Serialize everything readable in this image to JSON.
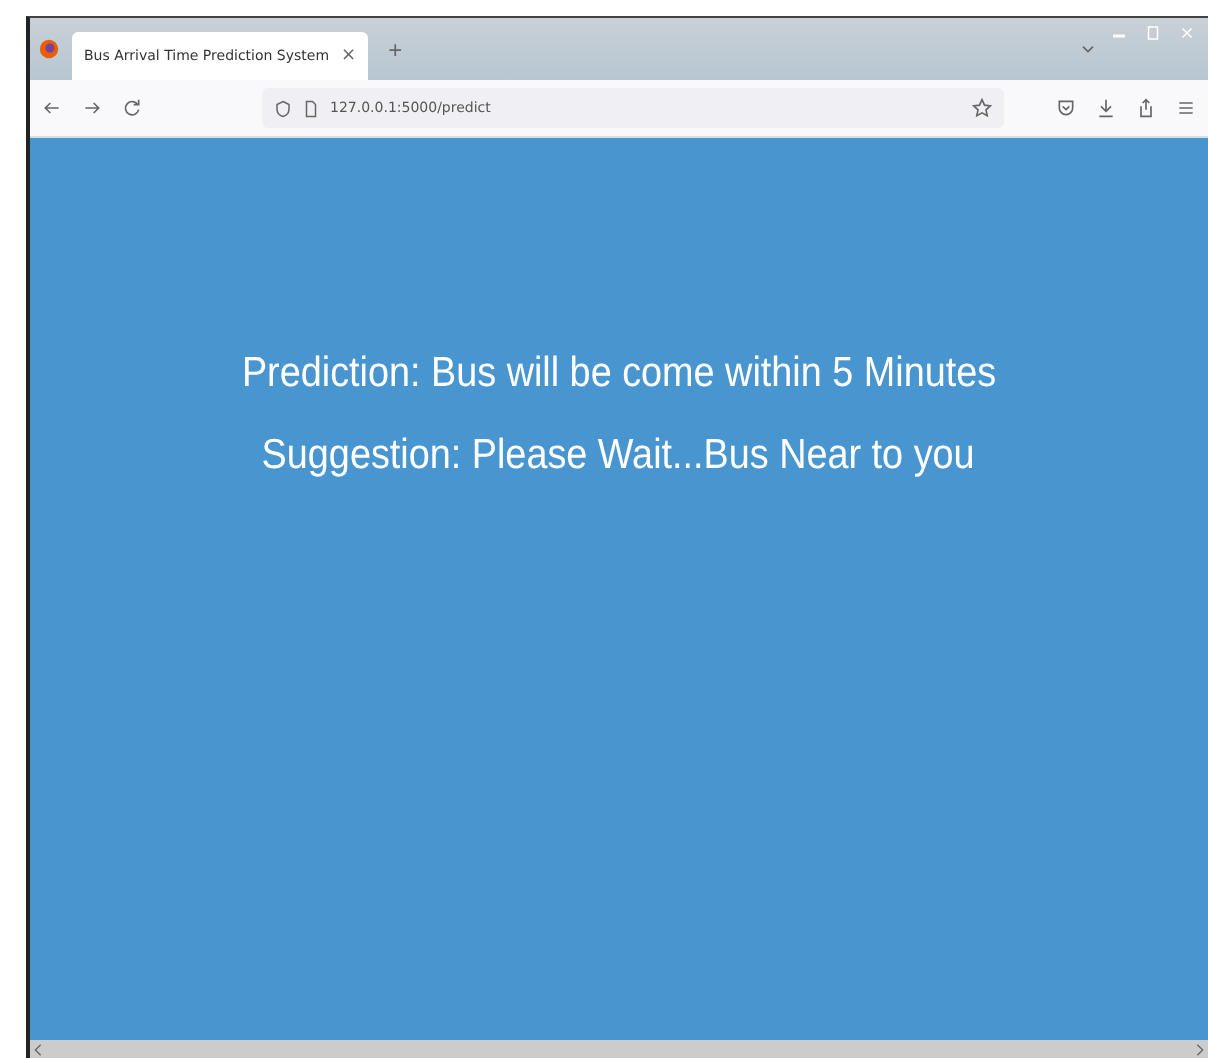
{
  "tab": {
    "title": "Bus Arrival Time Prediction System",
    "close": "×",
    "selected": true
  },
  "new_tab": "+",
  "address_bar": {
    "url": "127.0.0.1:5000/predict"
  },
  "content": {
    "lines": [
      "Prediction: Bus will be come within 5 Minutes",
      "Suggestion: Please Wait...Bus Near to you"
    ]
  }
}
